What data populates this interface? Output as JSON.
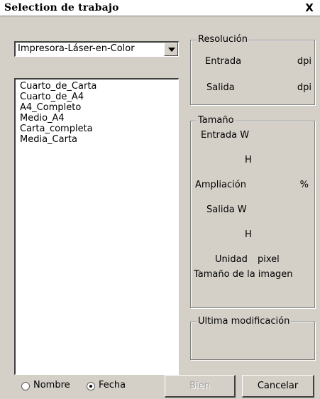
{
  "window": {
    "title": "Selection de trabajo",
    "close_glyph": "X"
  },
  "printer": {
    "selected": "Impresora-Láser-en-Color"
  },
  "job_list": {
    "items": [
      "Cuarto_de_Carta",
      "Cuarto_de_A4",
      "A4_Completo",
      "Medio_A4",
      "Carta_completa",
      "Media_Carta"
    ]
  },
  "resolution": {
    "legend": "Resolución",
    "input_label": "Entrada",
    "input_unit": "dpi",
    "output_label": "Salida",
    "output_unit": "dpi"
  },
  "size": {
    "legend": "Tamaño",
    "input_w": "Entrada W",
    "input_h": "H",
    "enlargement": "Ampliación",
    "enlargement_unit": "%",
    "output_w": "Salida W",
    "output_h": "H",
    "unit_label": "Unidad",
    "unit_value": "pixel",
    "image_size": "Tamaño de la imagen"
  },
  "last_modified": {
    "legend": "Ultima modificación"
  },
  "sort": {
    "name_label": "Nombre",
    "date_label": "Fecha",
    "selected": "Fecha"
  },
  "buttons": {
    "ok": "Bien",
    "cancel": "Cancelar"
  }
}
